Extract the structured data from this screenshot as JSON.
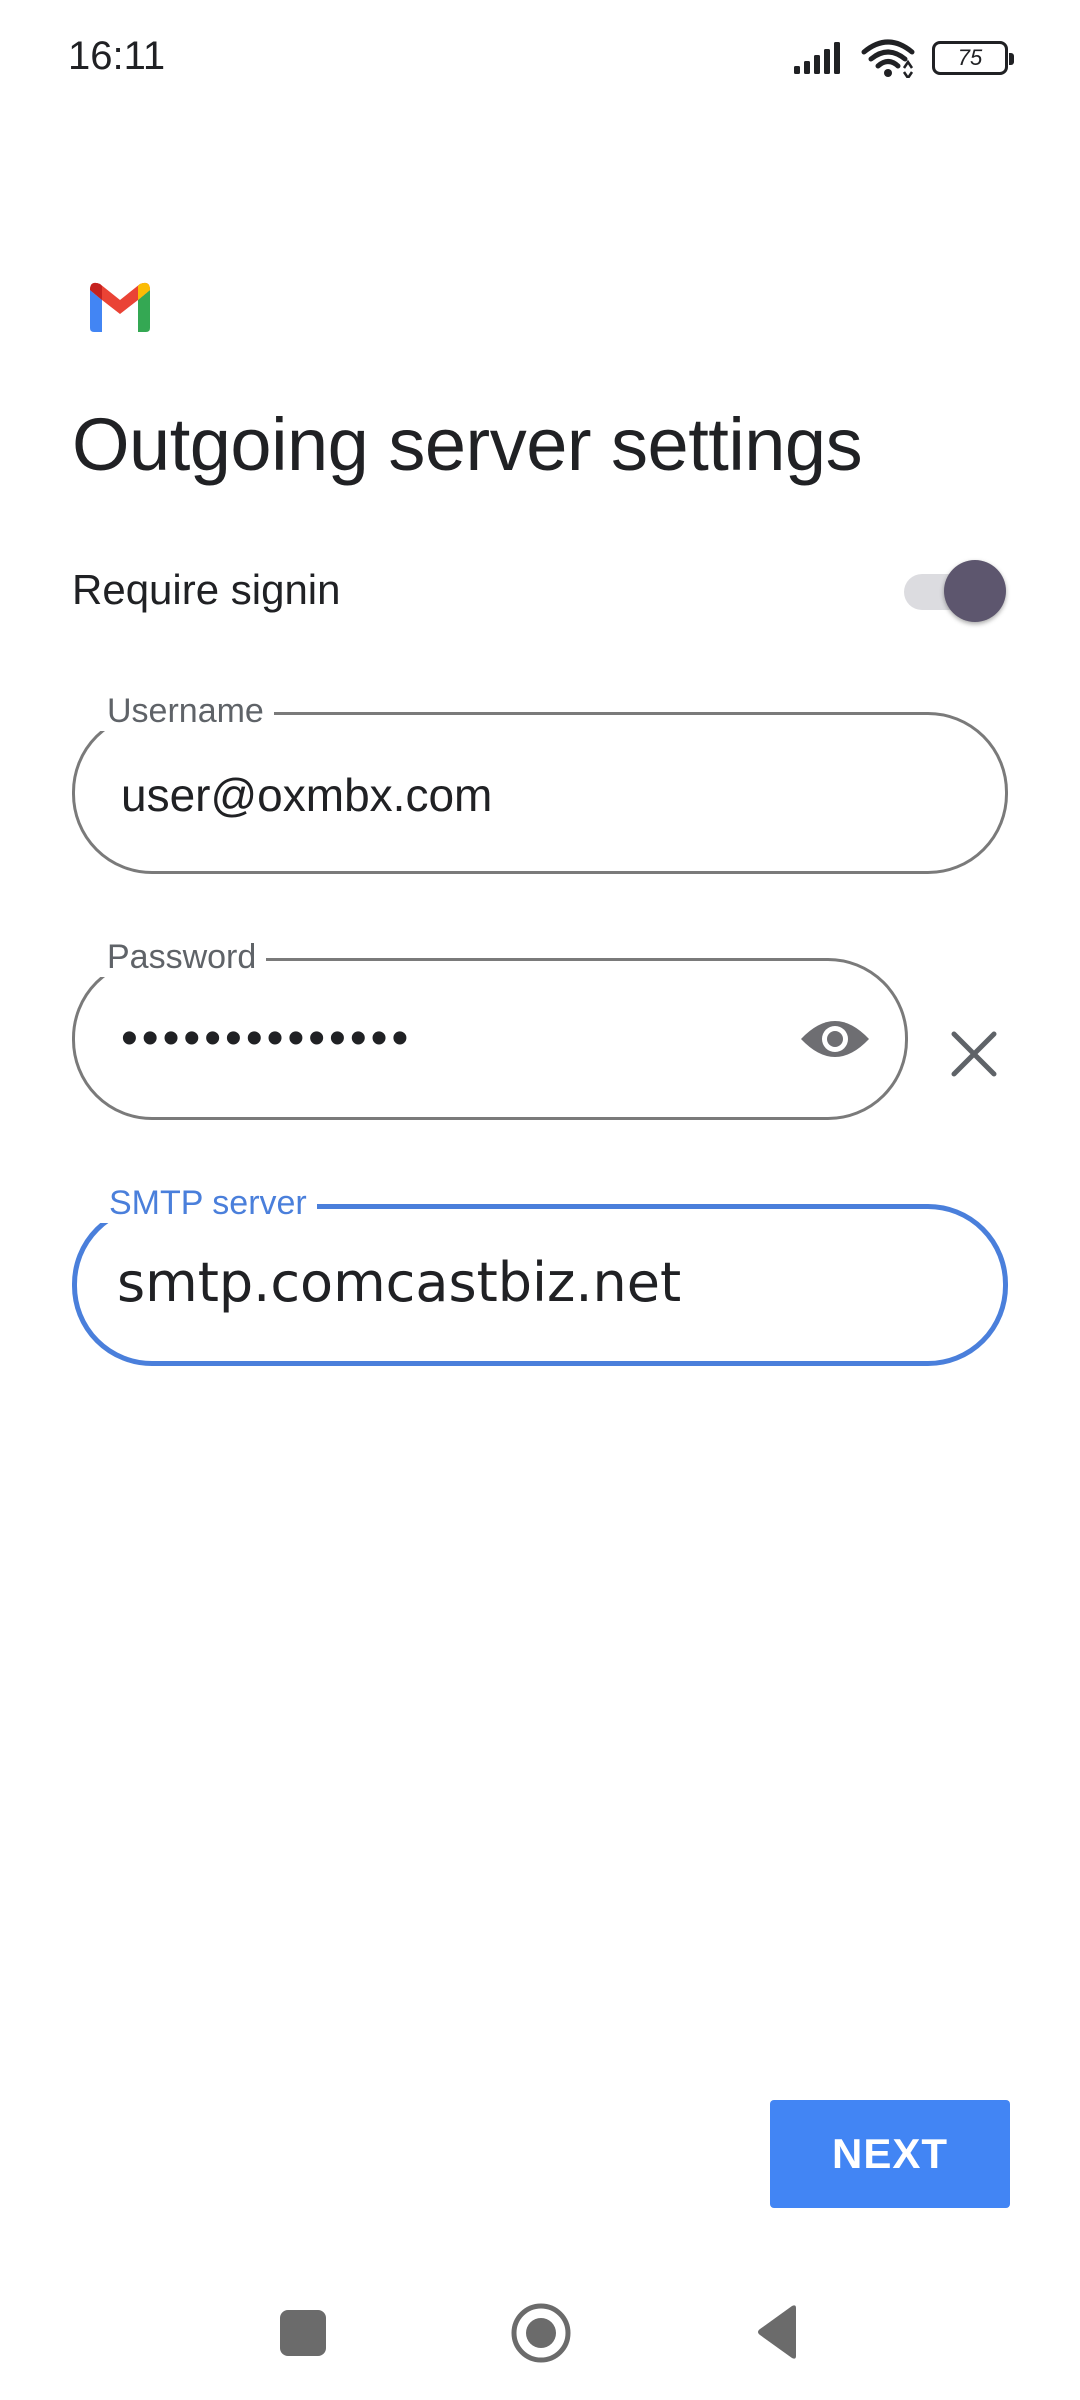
{
  "status_bar": {
    "time": "16:11",
    "battery_level": "75",
    "icons": [
      "signal-icon",
      "wifi-icon",
      "battery-icon"
    ]
  },
  "app": {
    "logo": "gmail-logo"
  },
  "page": {
    "title": "Outgoing server settings"
  },
  "require_signin": {
    "label": "Require signin",
    "enabled": true
  },
  "fields": {
    "username": {
      "label": "Username",
      "value": "user@oxmbx.com"
    },
    "password": {
      "label": "Password",
      "value": "••••••••••••••"
    },
    "smtp_server": {
      "label": "SMTP server",
      "value": "smtp.comcastbiz.net",
      "focused": true
    }
  },
  "actions": {
    "next_label": "NEXT"
  },
  "colors": {
    "accent": "#4285f4",
    "focus_outline": "#4a7fdb",
    "toggle_thumb": "#5d566e"
  },
  "navigation": {
    "icons": [
      "recents-icon",
      "home-icon",
      "back-icon"
    ]
  }
}
